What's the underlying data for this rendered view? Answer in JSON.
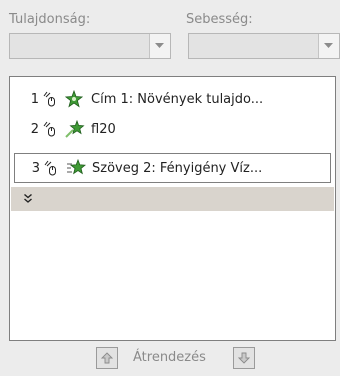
{
  "labels": {
    "property": "Tulajdonság:",
    "speed": "Sebesség:"
  },
  "list": {
    "items": [
      {
        "num": "1",
        "text": "Cím 1: Növények tulajdo..."
      },
      {
        "num": "2",
        "text": "fl20"
      },
      {
        "num": "3",
        "text": "Szöveg 2: Fényigény Víz..."
      }
    ]
  },
  "reorder": {
    "label": "Átrendezés"
  }
}
